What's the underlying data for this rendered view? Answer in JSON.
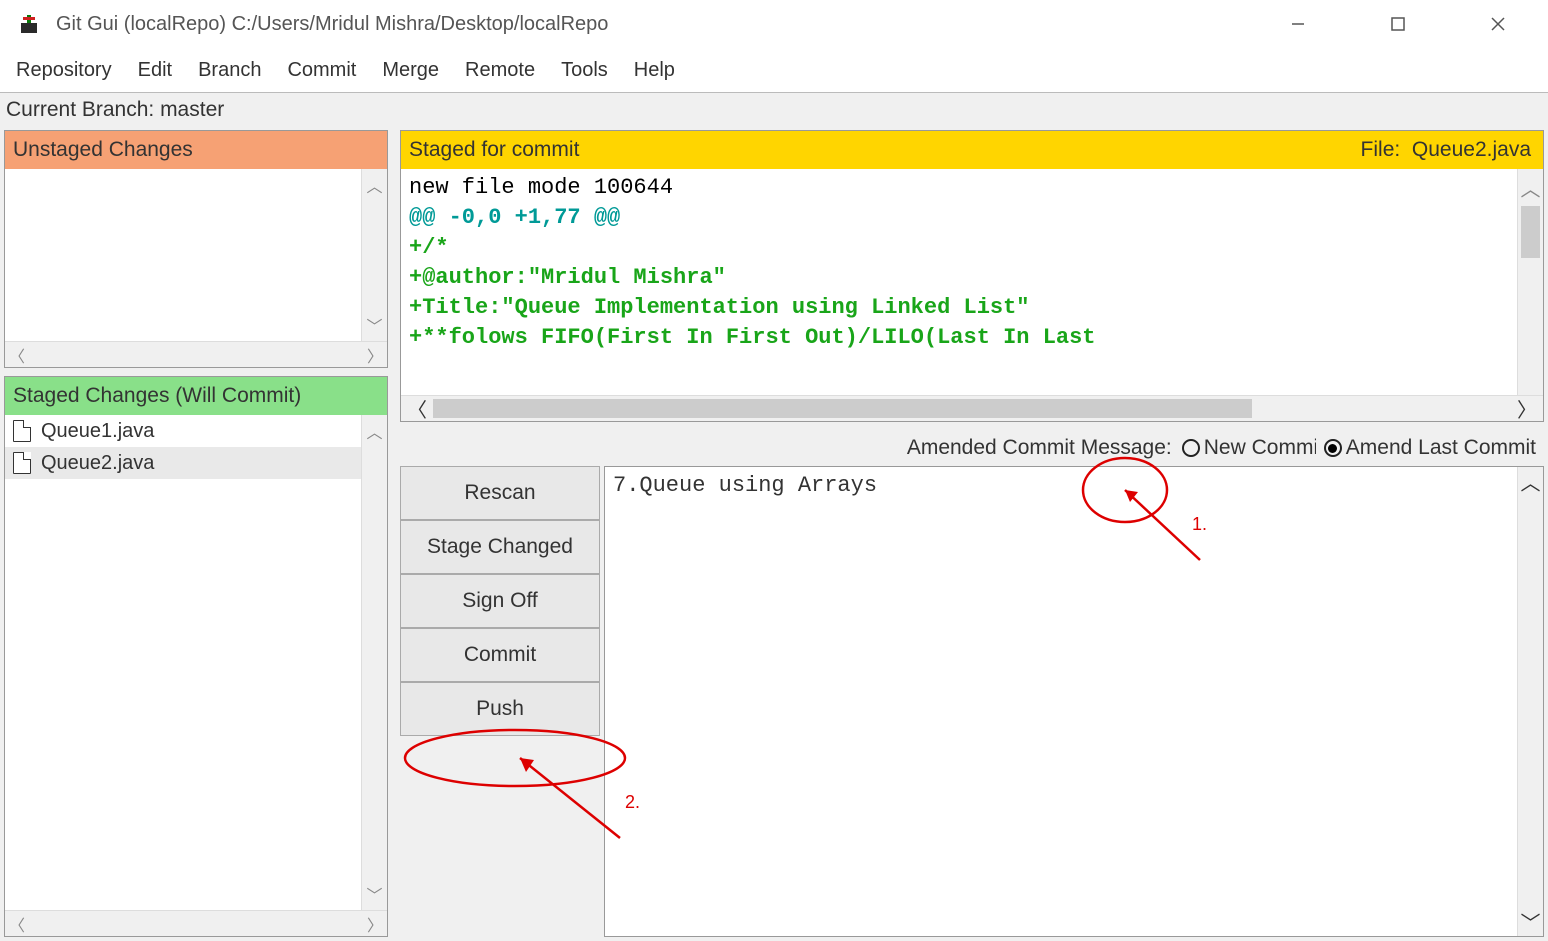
{
  "titlebar": {
    "title": "Git Gui (localRepo) C:/Users/Mridul Mishra/Desktop/localRepo"
  },
  "menu": {
    "items": [
      "Repository",
      "Edit",
      "Branch",
      "Commit",
      "Merge",
      "Remote",
      "Tools",
      "Help"
    ]
  },
  "branch": {
    "label": "Current Branch: master"
  },
  "left": {
    "unstaged_header": "Unstaged Changes",
    "staged_header": "Staged Changes (Will Commit)",
    "staged_files": [
      "Queue1.java",
      "Queue2.java"
    ],
    "staged_selected_index": 1
  },
  "diff": {
    "header_left": "Staged for commit",
    "header_right_label": "File:",
    "header_right_value": "Queue2.java",
    "lines": [
      {
        "cls": "diff-meta",
        "text": "new file mode 100644"
      },
      {
        "cls": "diff-hunk",
        "text": "@@ -0,0 +1,77 @@"
      },
      {
        "cls": "diff-add",
        "text": "+/*"
      },
      {
        "cls": "diff-add",
        "text": "+@author:\"Mridul Mishra\""
      },
      {
        "cls": "diff-add",
        "text": "+Title:\"Queue Implementation using Linked List\""
      },
      {
        "cls": "diff-add",
        "text": "+**folows FIFO(First In First Out)/LILO(Last In Last"
      }
    ]
  },
  "commit": {
    "opts_label": "Amended Commit Message:",
    "radio_new": "New Commit",
    "radio_amend": "Amend Last Commit",
    "amend_selected": true,
    "buttons": [
      "Rescan",
      "Stage Changed",
      "Sign Off",
      "Commit",
      "Push"
    ],
    "message": "7.Queue using Arrays"
  },
  "annotations": {
    "label1": "1.",
    "label2": "2."
  }
}
